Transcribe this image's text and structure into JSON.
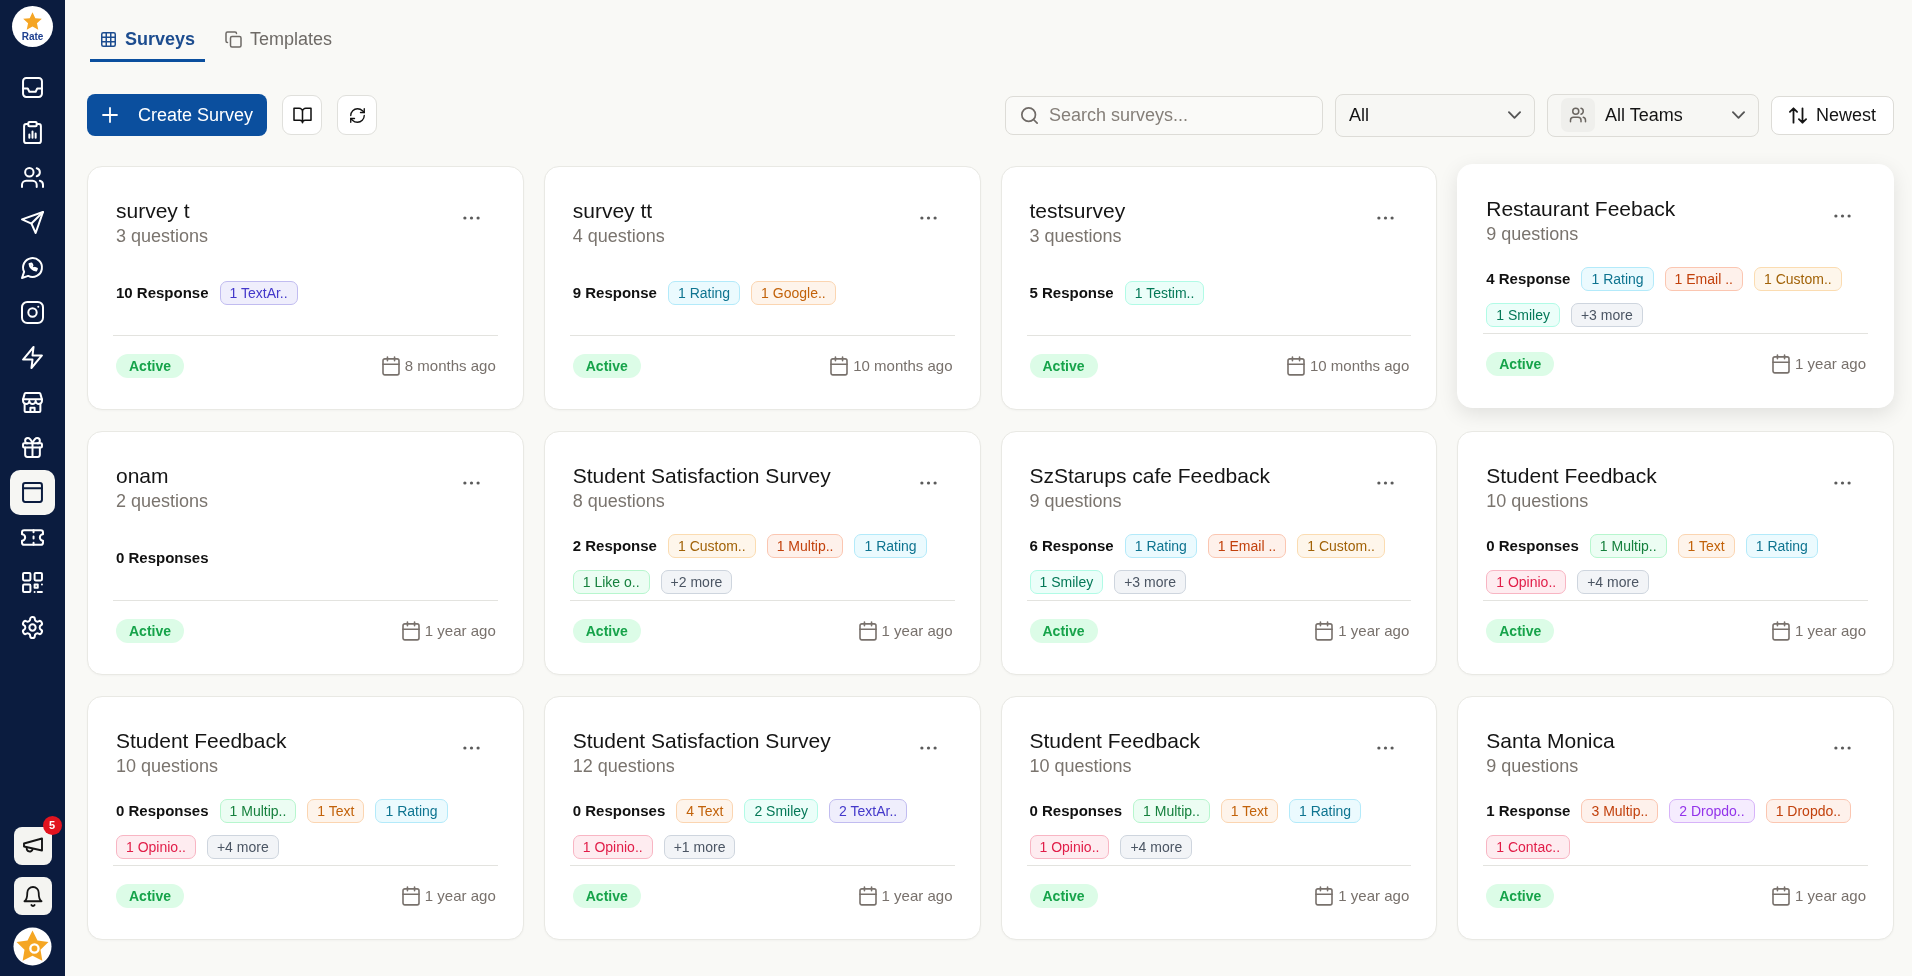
{
  "sidebar": {
    "logo": {
      "text": "Rate"
    },
    "items": [
      {
        "selected": false
      },
      {
        "selected": false
      },
      {
        "selected": false
      },
      {
        "selected": false
      },
      {
        "selected": false
      },
      {
        "selected": false
      },
      {
        "selected": false
      },
      {
        "selected": false
      },
      {
        "selected": false
      },
      {
        "selected": true
      },
      {
        "selected": false
      },
      {
        "selected": false
      },
      {
        "selected": false
      }
    ],
    "notification_badge": "5"
  },
  "tabs": [
    {
      "label": "Surveys",
      "selected": true
    },
    {
      "label": "Templates",
      "selected": false
    }
  ],
  "toolbar": {
    "create_button": {
      "label": "Create Survey"
    },
    "search": {
      "placeholder": "Search surveys..."
    },
    "status_filter": {
      "value": "All"
    },
    "team_filter": {
      "value": "All Teams"
    },
    "sort_button": {
      "label": "Newest"
    }
  },
  "cards": [
    {
      "title": "survey t",
      "questions": "3 questions",
      "responses": "10 Response",
      "tags": [
        {
          "label": "1 TextAr..",
          "color": "#4338ca"
        }
      ],
      "status": "Active",
      "date": "8 months ago",
      "hovered": false
    },
    {
      "title": "survey tt",
      "questions": "4 questions",
      "responses": "9 Response",
      "tags": [
        {
          "label": "1 Rating",
          "color": "#0e7490"
        },
        {
          "label": "1 Google..",
          "color": "#c2620a"
        }
      ],
      "status": "Active",
      "date": "10 months ago",
      "hovered": false
    },
    {
      "title": "testsurvey",
      "questions": "3 questions",
      "responses": "5 Response",
      "tags": [
        {
          "label": "1 Testim..",
          "color": "#047857"
        }
      ],
      "status": "Active",
      "date": "10 months ago",
      "hovered": false
    },
    {
      "title": "Restaurant Feeback",
      "questions": "9 questions",
      "responses": "4 Response",
      "tags": [
        {
          "label": "1 Rating",
          "color": "#0e7490"
        },
        {
          "label": "1 Email ..",
          "color": "#c2410c"
        },
        {
          "label": "1 Custom..",
          "color": "#a16207"
        },
        {
          "label": "1 Smiley",
          "color": "#047857"
        },
        {
          "label": "+3 more",
          "color": "#4b5563"
        }
      ],
      "status": "Active",
      "date": "1 year ago",
      "hovered": true
    },
    {
      "title": "onam",
      "questions": "2 questions",
      "responses": "0 Responses",
      "status": "Active",
      "date": "1 year ago",
      "hovered": false
    },
    {
      "title": "Student Satisfaction Survey",
      "questions": "8 questions",
      "responses": "2 Response",
      "tags": [
        {
          "label": "1 Custom..",
          "color": "#a16207"
        },
        {
          "label": "1 Multip..",
          "color": "#c2410c"
        },
        {
          "label": "1 Rating",
          "color": "#0e7490"
        },
        {
          "label": "1 Like o..",
          "color": "#15803d"
        },
        {
          "label": "+2 more",
          "color": "#4b5563"
        }
      ],
      "status": "Active",
      "date": "1 year ago",
      "hovered": false
    },
    {
      "title": "SzStarups cafe Feedback",
      "questions": "9 questions",
      "responses": "6 Response",
      "tags": [
        {
          "label": "1 Rating",
          "color": "#0e7490"
        },
        {
          "label": "1 Email ..",
          "color": "#c2410c"
        },
        {
          "label": "1 Custom..",
          "color": "#a16207"
        },
        {
          "label": "1 Smiley",
          "color": "#047857"
        },
        {
          "label": "+3 more",
          "color": "#4b5563"
        }
      ],
      "status": "Active",
      "date": "1 year ago",
      "hovered": false
    },
    {
      "title": "Student Feedback",
      "questions": "10 questions",
      "responses": "0 Responses",
      "tags": [
        {
          "label": "1 Multip..",
          "color": "#15803d"
        },
        {
          "label": "1 Text",
          "color": "#c2620a"
        },
        {
          "label": "1 Rating",
          "color": "#0e7490"
        },
        {
          "label": "1 Opinio..",
          "color": "#e11d48"
        },
        {
          "label": "+4 more",
          "color": "#4b5563"
        }
      ],
      "status": "Active",
      "date": "1 year ago",
      "hovered": false
    },
    {
      "title": "Student Feedback",
      "questions": "10 questions",
      "responses": "0 Responses",
      "tags": [
        {
          "label": "1 Multip..",
          "color": "#15803d"
        },
        {
          "label": "1 Text",
          "color": "#c2620a"
        },
        {
          "label": "1 Rating",
          "color": "#0e7490"
        },
        {
          "label": "1 Opinio..",
          "color": "#e11d48"
        },
        {
          "label": "+4 more",
          "color": "#4b5563"
        }
      ],
      "status": "Active",
      "date": "1 year ago",
      "hovered": false
    },
    {
      "title": "Student Satisfaction Survey",
      "questions": "12 questions",
      "responses": "0 Responses",
      "tags": [
        {
          "label": "4 Text",
          "color": "#c2620a"
        },
        {
          "label": "2 Smiley",
          "color": "#047857"
        },
        {
          "label": "2 TextAr..",
          "color": "#4338ca"
        },
        {
          "label": "1 Opinio..",
          "color": "#e11d48"
        },
        {
          "label": "+1 more",
          "color": "#4b5563"
        }
      ],
      "status": "Active",
      "date": "1 year ago",
      "hovered": false
    },
    {
      "title": "Student Feedback",
      "questions": "10 questions",
      "responses": "0 Responses",
      "tags": [
        {
          "label": "1 Multip..",
          "color": "#15803d"
        },
        {
          "label": "1 Text",
          "color": "#c2620a"
        },
        {
          "label": "1 Rating",
          "color": "#0e7490"
        },
        {
          "label": "1 Opinio..",
          "color": "#e11d48"
        },
        {
          "label": "+4 more",
          "color": "#4b5563"
        }
      ],
      "status": "Active",
      "date": "1 year ago",
      "hovered": false
    },
    {
      "title": "Santa Monica",
      "questions": "9 questions",
      "responses": "1 Response",
      "tags": [
        {
          "label": "3 Multip..",
          "color": "#c2410c"
        },
        {
          "label": "2 Dropdo..",
          "color": "#9333ea"
        },
        {
          "label": "1 Dropdo..",
          "color": "#c2410c"
        },
        {
          "label": "1 Contac..",
          "color": "#e11d48"
        }
      ],
      "status": "Active",
      "date": "1 year ago",
      "hovered": false
    }
  ]
}
